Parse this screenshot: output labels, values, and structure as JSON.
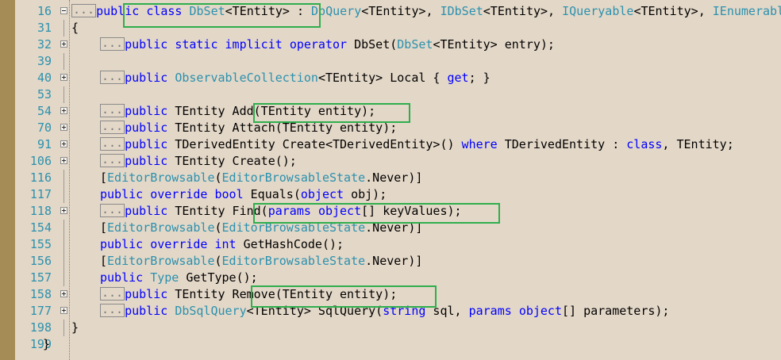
{
  "highlight_color": "#2eae4d",
  "line_number_color": "#2b91af",
  "keyword_color": "#0000ff",
  "type_color": "#2b91af",
  "lines": [
    {
      "num": "16",
      "toggle": "minus",
      "indent": 1,
      "tokens": [
        {
          "t": "e",
          "v": "..."
        },
        {
          "t": "k",
          "v": "public"
        },
        {
          "t": "p",
          "v": " "
        },
        {
          "t": "k",
          "v": "class"
        },
        {
          "t": "p",
          "v": " "
        },
        {
          "t": "y",
          "v": "DbSet"
        },
        {
          "t": "p",
          "v": "<TEntity> : "
        },
        {
          "t": "y",
          "v": "DbQuery"
        },
        {
          "t": "p",
          "v": "<TEntity>, "
        },
        {
          "t": "y",
          "v": "IDbSet"
        },
        {
          "t": "p",
          "v": "<TEntity>, "
        },
        {
          "t": "y",
          "v": "IQueryable"
        },
        {
          "t": "p",
          "v": "<TEntity>, "
        },
        {
          "t": "y",
          "v": "IEnumerable"
        }
      ]
    },
    {
      "num": "31",
      "toggle": "",
      "indent": 1,
      "tokens": [
        {
          "t": "p",
          "v": "{"
        }
      ]
    },
    {
      "num": "32",
      "toggle": "plus",
      "indent": 2,
      "tokens": [
        {
          "t": "e",
          "v": "..."
        },
        {
          "t": "k",
          "v": "public"
        },
        {
          "t": "p",
          "v": " "
        },
        {
          "t": "k",
          "v": "static"
        },
        {
          "t": "p",
          "v": " "
        },
        {
          "t": "k",
          "v": "implicit"
        },
        {
          "t": "p",
          "v": " "
        },
        {
          "t": "k",
          "v": "operator"
        },
        {
          "t": "p",
          "v": " DbSet("
        },
        {
          "t": "y",
          "v": "DbSet"
        },
        {
          "t": "p",
          "v": "<TEntity> entry);"
        }
      ]
    },
    {
      "num": "39",
      "toggle": "",
      "indent": 0,
      "tokens": []
    },
    {
      "num": "40",
      "toggle": "plus",
      "indent": 2,
      "tokens": [
        {
          "t": "e",
          "v": "..."
        },
        {
          "t": "k",
          "v": "public"
        },
        {
          "t": "p",
          "v": " "
        },
        {
          "t": "y",
          "v": "ObservableCollection"
        },
        {
          "t": "p",
          "v": "<TEntity> Local { "
        },
        {
          "t": "k",
          "v": "get"
        },
        {
          "t": "p",
          "v": "; }"
        }
      ]
    },
    {
      "num": "53",
      "toggle": "",
      "indent": 0,
      "tokens": []
    },
    {
      "num": "54",
      "toggle": "plus",
      "indent": 2,
      "tokens": [
        {
          "t": "e",
          "v": "..."
        },
        {
          "t": "k",
          "v": "public"
        },
        {
          "t": "p",
          "v": " TEntity Add(TEntity entity);"
        }
      ]
    },
    {
      "num": "70",
      "toggle": "plus",
      "indent": 2,
      "tokens": [
        {
          "t": "e",
          "v": "..."
        },
        {
          "t": "k",
          "v": "public"
        },
        {
          "t": "p",
          "v": " TEntity Attach(TEntity entity);"
        }
      ]
    },
    {
      "num": "91",
      "toggle": "plus",
      "indent": 2,
      "tokens": [
        {
          "t": "e",
          "v": "..."
        },
        {
          "t": "k",
          "v": "public"
        },
        {
          "t": "p",
          "v": " TDerivedEntity Create<TDerivedEntity>() "
        },
        {
          "t": "k",
          "v": "where"
        },
        {
          "t": "p",
          "v": " TDerivedEntity : "
        },
        {
          "t": "k",
          "v": "class"
        },
        {
          "t": "p",
          "v": ", TEntity;"
        }
      ]
    },
    {
      "num": "106",
      "toggle": "plus",
      "indent": 2,
      "tokens": [
        {
          "t": "e",
          "v": "..."
        },
        {
          "t": "k",
          "v": "public"
        },
        {
          "t": "p",
          "v": " TEntity Create();"
        }
      ]
    },
    {
      "num": "116",
      "toggle": "",
      "indent": 2,
      "tokens": [
        {
          "t": "p",
          "v": "["
        },
        {
          "t": "y",
          "v": "EditorBrowsable"
        },
        {
          "t": "p",
          "v": "("
        },
        {
          "t": "y",
          "v": "EditorBrowsableState"
        },
        {
          "t": "p",
          "v": ".Never)]"
        }
      ]
    },
    {
      "num": "117",
      "toggle": "",
      "indent": 2,
      "tokens": [
        {
          "t": "k",
          "v": "public"
        },
        {
          "t": "p",
          "v": " "
        },
        {
          "t": "k",
          "v": "override"
        },
        {
          "t": "p",
          "v": " "
        },
        {
          "t": "k",
          "v": "bool"
        },
        {
          "t": "p",
          "v": " Equals("
        },
        {
          "t": "k",
          "v": "object"
        },
        {
          "t": "p",
          "v": " obj);"
        }
      ]
    },
    {
      "num": "118",
      "toggle": "plus",
      "indent": 2,
      "tokens": [
        {
          "t": "e",
          "v": "..."
        },
        {
          "t": "k",
          "v": "public"
        },
        {
          "t": "p",
          "v": " TEntity Find("
        },
        {
          "t": "k",
          "v": "params"
        },
        {
          "t": "p",
          "v": " "
        },
        {
          "t": "k",
          "v": "object"
        },
        {
          "t": "p",
          "v": "[] keyValues);"
        }
      ]
    },
    {
      "num": "154",
      "toggle": "",
      "indent": 2,
      "tokens": [
        {
          "t": "p",
          "v": "["
        },
        {
          "t": "y",
          "v": "EditorBrowsable"
        },
        {
          "t": "p",
          "v": "("
        },
        {
          "t": "y",
          "v": "EditorBrowsableState"
        },
        {
          "t": "p",
          "v": ".Never)]"
        }
      ]
    },
    {
      "num": "155",
      "toggle": "",
      "indent": 2,
      "tokens": [
        {
          "t": "k",
          "v": "public"
        },
        {
          "t": "p",
          "v": " "
        },
        {
          "t": "k",
          "v": "override"
        },
        {
          "t": "p",
          "v": " "
        },
        {
          "t": "k",
          "v": "int"
        },
        {
          "t": "p",
          "v": " GetHashCode();"
        }
      ]
    },
    {
      "num": "156",
      "toggle": "",
      "indent": 2,
      "tokens": [
        {
          "t": "p",
          "v": "["
        },
        {
          "t": "y",
          "v": "EditorBrowsable"
        },
        {
          "t": "p",
          "v": "("
        },
        {
          "t": "y",
          "v": "EditorBrowsableState"
        },
        {
          "t": "p",
          "v": ".Never)]"
        }
      ]
    },
    {
      "num": "157",
      "toggle": "",
      "indent": 2,
      "tokens": [
        {
          "t": "k",
          "v": "public"
        },
        {
          "t": "p",
          "v": " "
        },
        {
          "t": "y",
          "v": "Type"
        },
        {
          "t": "p",
          "v": " GetType();"
        }
      ]
    },
    {
      "num": "158",
      "toggle": "plus",
      "indent": 2,
      "tokens": [
        {
          "t": "e",
          "v": "..."
        },
        {
          "t": "k",
          "v": "public"
        },
        {
          "t": "p",
          "v": " TEntity Remove(TEntity entity);"
        }
      ]
    },
    {
      "num": "177",
      "toggle": "plus",
      "indent": 2,
      "tokens": [
        {
          "t": "e",
          "v": "..."
        },
        {
          "t": "k",
          "v": "public"
        },
        {
          "t": "p",
          "v": " "
        },
        {
          "t": "y",
          "v": "DbSqlQuery"
        },
        {
          "t": "p",
          "v": "<TEntity> SqlQuery("
        },
        {
          "t": "k",
          "v": "string"
        },
        {
          "t": "p",
          "v": " sql, "
        },
        {
          "t": "k",
          "v": "params"
        },
        {
          "t": "p",
          "v": " "
        },
        {
          "t": "k",
          "v": "object"
        },
        {
          "t": "p",
          "v": "[] parameters);"
        }
      ]
    },
    {
      "num": "198",
      "toggle": "",
      "indent": 1,
      "tokens": [
        {
          "t": "p",
          "v": "}"
        }
      ]
    },
    {
      "num": "199",
      "toggle": "",
      "indent": 0,
      "tokens": [
        {
          "t": "p",
          "v": "}"
        }
      ]
    }
  ]
}
